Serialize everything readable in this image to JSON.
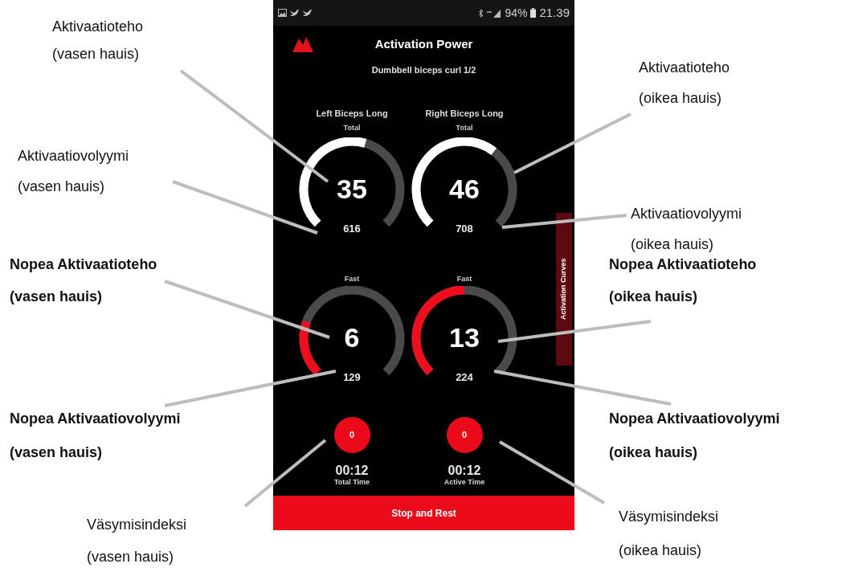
{
  "status_bar": {
    "battery": "94%",
    "time": "21.39"
  },
  "header": {
    "title": "Activation Power",
    "subtitle": "Dumbbell biceps curl 1/2"
  },
  "columns": [
    {
      "muscle": "Left Biceps Long",
      "gauges": [
        {
          "kind": "total",
          "label": "Total",
          "value": "35",
          "volume": "616"
        },
        {
          "kind": "fast",
          "label": "Fast",
          "value": "6",
          "volume": "129"
        }
      ],
      "fatigue": "0",
      "time": "00:12",
      "time_label": "Total Time"
    },
    {
      "muscle": "Right Biceps Long",
      "gauges": [
        {
          "kind": "total",
          "label": "Total",
          "value": "46",
          "volume": "708"
        },
        {
          "kind": "fast",
          "label": "Fast",
          "value": "13",
          "volume": "224"
        }
      ],
      "fatigue": "0",
      "time": "00:12",
      "time_label": "Active Time"
    }
  ],
  "side_tab": "Activation Curves",
  "button": "Stop and Rest",
  "annotations": [
    {
      "title": "Aktivaatioteho",
      "subtitle": "(vasen hauis)"
    },
    {
      "title": "Aktivaatioteho",
      "subtitle": "(oikea hauis)"
    },
    {
      "title": "Aktivaatiovolyymi",
      "subtitle": "(vasen hauis)"
    },
    {
      "title": "Aktivaatiovolyymi",
      "subtitle": "(oikea hauis)"
    },
    {
      "title": "Nopea Aktivaatioteho",
      "subtitle": "(vasen hauis)"
    },
    {
      "title": "Nopea Aktivaatioteho",
      "subtitle": "(oikea hauis)"
    },
    {
      "title": "Nopea Aktivaatiovolyymi",
      "subtitle": "(vasen hauis)"
    },
    {
      "title": "Nopea Aktivaatiovolyymi",
      "subtitle": "(oikea hauis)"
    },
    {
      "title": "Väsymisindeksi",
      "subtitle": "(vasen hauis)"
    },
    {
      "title": "Väsymisindeksi",
      "subtitle": "(oikea hauis)"
    }
  ]
}
